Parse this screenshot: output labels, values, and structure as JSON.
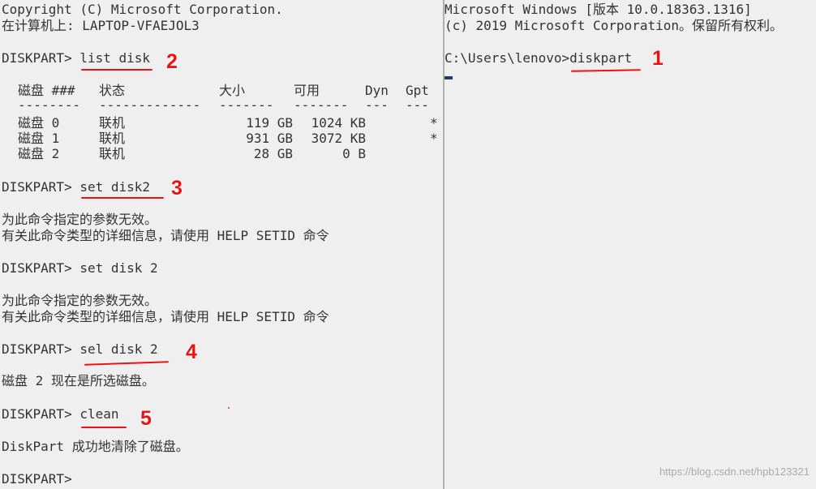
{
  "left": {
    "copyright": "Copyright (C) Microsoft Corporation.",
    "computer": "在计算机上: LAPTOP-VFAEJOL3",
    "cmd_list": "DISKPART> list disk",
    "table_headers": [
      "磁盘 ###",
      "状态",
      "大小",
      "可用",
      "Dyn",
      "Gpt"
    ],
    "table_sep": [
      "--------",
      "-------------",
      "-------",
      "-------",
      "---",
      "---"
    ],
    "rows": [
      [
        "磁盘 0",
        "联机",
        "119 GB",
        "1024 KB",
        "",
        "*"
      ],
      [
        "磁盘 1",
        "联机",
        "931 GB",
        "3072 KB",
        "",
        "*"
      ],
      [
        "磁盘 2",
        "联机",
        "28 GB",
        "0 B",
        "",
        ""
      ]
    ],
    "cmd_set1": "DISKPART> set disk2",
    "err1a": "为此命令指定的参数无效。",
    "err1b": "有关此命令类型的详细信息，请使用 HELP SETID 命令",
    "cmd_set2": "DISKPART> set disk 2",
    "err2a": "为此命令指定的参数无效。",
    "err2b": "有关此命令类型的详细信息，请使用 HELP SETID 命令",
    "cmd_sel": "DISKPART> sel disk 2",
    "sel_result": "磁盘 2 现在是所选磁盘。",
    "cmd_clean": "DISKPART> clean",
    "clean_result": "DiskPart 成功地清除了磁盘。",
    "prompt": "DISKPART>"
  },
  "right": {
    "version": "Microsoft Windows [版本 10.0.18363.1316]",
    "copyright": "(c) 2019 Microsoft Corporation。保留所有权利。",
    "cmd": "C:\\Users\\lenovo>diskpart"
  },
  "annotations": [
    "1",
    "2",
    "3",
    "4",
    "5"
  ],
  "annotation_color": "#e11111",
  "watermark": "https://blog.csdn.net/hpb123321"
}
